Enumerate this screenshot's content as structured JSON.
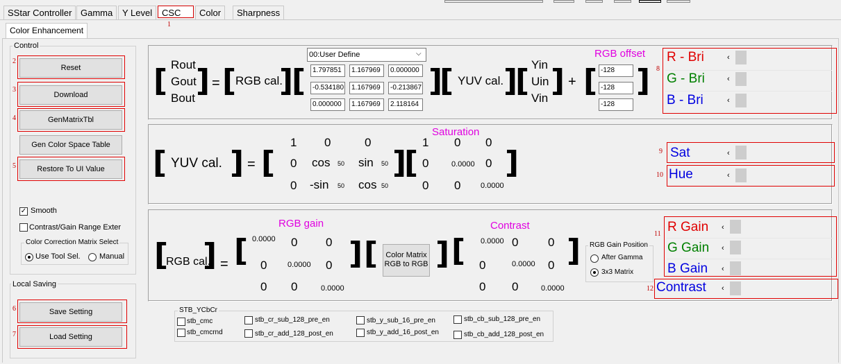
{
  "tabs": [
    "SStar Controller",
    "Gamma",
    "Y Level",
    "CSC",
    "Color",
    "Sharpness"
  ],
  "csc_tab_number": "1",
  "subtab": "Color Enhancement",
  "control": {
    "title": "Control",
    "buttons": [
      {
        "label": "Reset",
        "num": "2"
      },
      {
        "label": "Download",
        "num": "3"
      },
      {
        "label": "GenMatrixTbl",
        "num": "4"
      },
      {
        "label": "Gen Color Space Table",
        "num": ""
      },
      {
        "label": "Restore To UI Value",
        "num": "5"
      }
    ],
    "smooth_label": "Smooth",
    "smooth_checked": true,
    "range_label": "Contrast/Gain Range Exter",
    "range_checked": false,
    "ccm_title": "Color Correction Matrix Select",
    "ccm_options": [
      "Use Tool Sel.",
      "Manual"
    ],
    "ccm_selected": "Use Tool Sel."
  },
  "local_saving": {
    "title": "Local Saving",
    "buttons": [
      {
        "label": "Save Setting",
        "num": "6"
      },
      {
        "label": "Load Setting",
        "num": "7"
      }
    ]
  },
  "eq1": {
    "rgb_out": [
      "Rout",
      "Gout",
      "Bout"
    ],
    "rgb_cal": "RGB cal.",
    "preset": "00:User Define",
    "matrix": [
      [
        "1.797851",
        "1.167969",
        "0.000000"
      ],
      [
        "-0.534180",
        "1.167969",
        "-0.213867"
      ],
      [
        "0.000000",
        "1.167969",
        "2.118164"
      ]
    ],
    "yuv_cal": "YUV cal.",
    "yuv_in": [
      "Yin",
      "Uin",
      "Vin"
    ],
    "offset_title": "RGB offset",
    "offsets": [
      "-128",
      "-128",
      "-128"
    ]
  },
  "bri": {
    "num": "8",
    "items": [
      {
        "label": "R - Bri",
        "color": "#e00000"
      },
      {
        "label": "G - Bri",
        "color": "#008000"
      },
      {
        "label": "B - Bri",
        "color": "#0000e0"
      }
    ]
  },
  "eq2": {
    "yuv_cal": "YUV cal.",
    "rot": [
      "1",
      "0",
      "0",
      "0",
      "cos",
      "sin",
      "0",
      "-sin",
      "cos"
    ],
    "sub": "50",
    "sat_title": "Saturation",
    "sat": [
      "1",
      "0",
      "0",
      "0",
      "0.0000",
      "0",
      "0",
      "0",
      "0.0000"
    ]
  },
  "sat": {
    "num": "9",
    "label": "Sat",
    "color": "#0000e0"
  },
  "hue": {
    "num": "10",
    "label": "Hue",
    "color": "#0000e0"
  },
  "eq3": {
    "rgb_cal": "RGB cal.",
    "gain_title": "RGB gain",
    "gain": [
      "0.0000",
      "0",
      "0",
      "0",
      "0.0000",
      "0",
      "0",
      "0",
      "0.0000"
    ],
    "cm_button": "Color Matrix RGB to RGB",
    "contrast_title": "Contrast",
    "contrast": [
      "0.0000",
      "0",
      "0",
      "0",
      "0.0000",
      "0",
      "0",
      "0",
      "0.0000"
    ],
    "gain_pos_title": "RGB Gain Position",
    "gain_pos": [
      "After Gamma",
      "3x3 Matrix"
    ],
    "gain_pos_selected": "3x3 Matrix"
  },
  "gain": {
    "num": "11",
    "items": [
      {
        "label": "R Gain",
        "color": "#e00000"
      },
      {
        "label": "G Gain",
        "color": "#008000"
      },
      {
        "label": "B Gain",
        "color": "#0000e0"
      }
    ]
  },
  "contrast": {
    "num": "12",
    "label": "Contrast",
    "color": "#0000e0"
  },
  "stb": {
    "title": "STB_YCbCr",
    "items": [
      "stb_cmc",
      "stb_cmcrnd",
      "stb_cr_sub_128_pre_en",
      "stb_cr_add_128_post_en",
      "stb_y_sub_16_pre_en",
      "stb_y_add_16_post_en",
      "stb_cb_sub_128_pre_en",
      "stb_cb_add_128_post_en"
    ]
  }
}
